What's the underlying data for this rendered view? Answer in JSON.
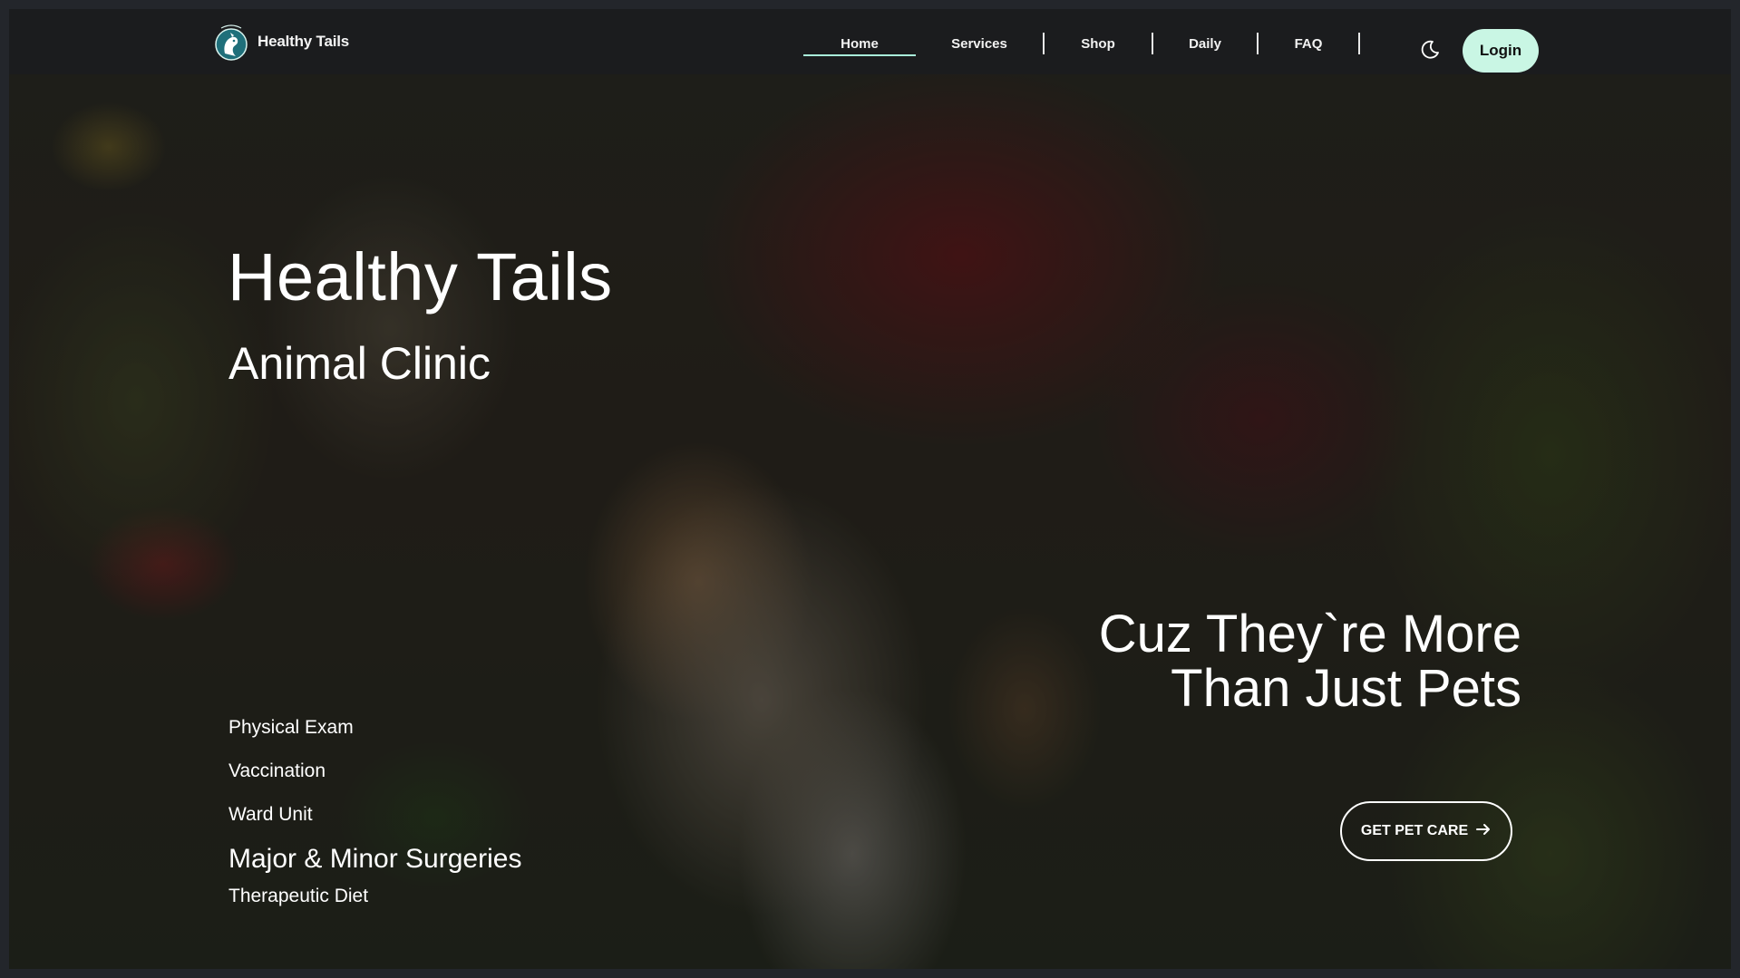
{
  "brand": {
    "name": "Healthy Tails",
    "logo_icon": "dog-cat-logo-icon"
  },
  "nav": {
    "items": [
      {
        "label": "Home",
        "active": true
      },
      {
        "label": "Services"
      },
      {
        "label": "Shop"
      },
      {
        "label": "Daily"
      },
      {
        "label": "FAQ"
      }
    ],
    "theme_toggle_icon": "moon-icon",
    "login_label": "Login"
  },
  "hero": {
    "title": "Healthy Tails",
    "subtitle": "Animal Clinic",
    "services": [
      "Physical Exam",
      "Vaccination",
      "Ward Unit",
      "Major & Minor Surgeries",
      "Therapeutic Diet"
    ],
    "tagline": "Cuz They`re More Than Just Pets",
    "cta_label": "GET PET CARE",
    "cta_icon": "arrow-right-icon"
  },
  "colors": {
    "accent": "#a9f0da",
    "login_bg": "#c9f6e4",
    "navbar_bg": "#1b1c1e"
  }
}
